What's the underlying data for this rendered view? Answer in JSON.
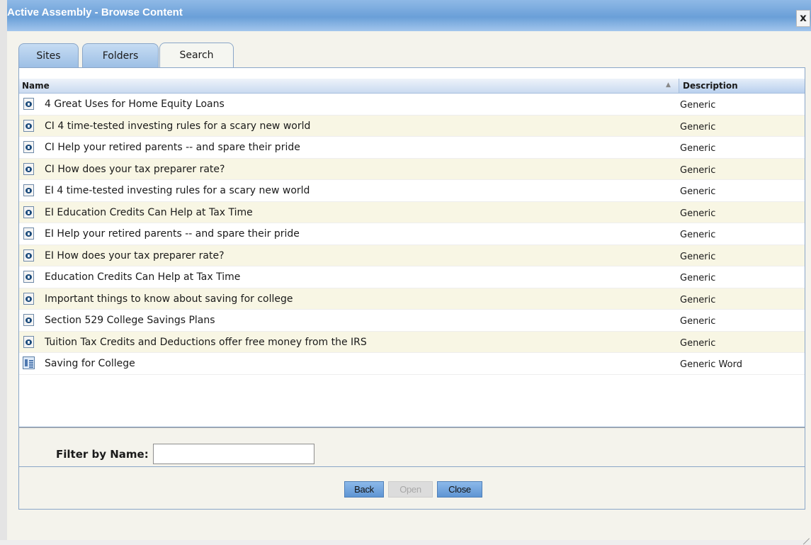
{
  "window": {
    "title": "Active Assembly - Browse Content",
    "close_glyph": "x"
  },
  "tabs": [
    {
      "label": "Sites",
      "active": false
    },
    {
      "label": "Folders",
      "active": false
    },
    {
      "label": "Search",
      "active": true
    }
  ],
  "grid": {
    "columns": {
      "name": "Name",
      "description": "Description"
    },
    "sort_indicator": "▲",
    "rows": [
      {
        "name": "4 Great Uses for Home Equity Loans",
        "description": "Generic",
        "icon": "document-icon"
      },
      {
        "name": "CI 4 time-tested investing rules for a scary new world",
        "description": "Generic",
        "icon": "document-icon"
      },
      {
        "name": "CI Help your retired parents -- and spare their pride",
        "description": "Generic",
        "icon": "document-icon"
      },
      {
        "name": "CI How does your tax preparer rate?",
        "description": "Generic",
        "icon": "document-icon"
      },
      {
        "name": "EI 4 time-tested investing rules for a scary new world",
        "description": "Generic",
        "icon": "document-icon"
      },
      {
        "name": "EI Education Credits Can Help at Tax Time",
        "description": "Generic",
        "icon": "document-icon"
      },
      {
        "name": "EI Help your retired parents -- and spare their pride",
        "description": "Generic",
        "icon": "document-icon"
      },
      {
        "name": "EI How does your tax preparer rate?",
        "description": "Generic",
        "icon": "document-icon"
      },
      {
        "name": "Education Credits Can Help at Tax Time",
        "description": "Generic",
        "icon": "document-icon"
      },
      {
        "name": "Important things to know about saving for college",
        "description": "Generic",
        "icon": "document-icon"
      },
      {
        "name": "Section 529 College Savings Plans",
        "description": "Generic",
        "icon": "document-icon"
      },
      {
        "name": "Tuition Tax Credits and Deductions offer free money from the IRS",
        "description": "Generic",
        "icon": "document-icon"
      },
      {
        "name": "Saving for College",
        "description": "Generic Word",
        "icon": "word-document-icon"
      }
    ]
  },
  "filter": {
    "label": "Filter by Name:",
    "value": "",
    "placeholder": ""
  },
  "buttons": {
    "back": "Back",
    "open": "Open",
    "close": "Close"
  }
}
